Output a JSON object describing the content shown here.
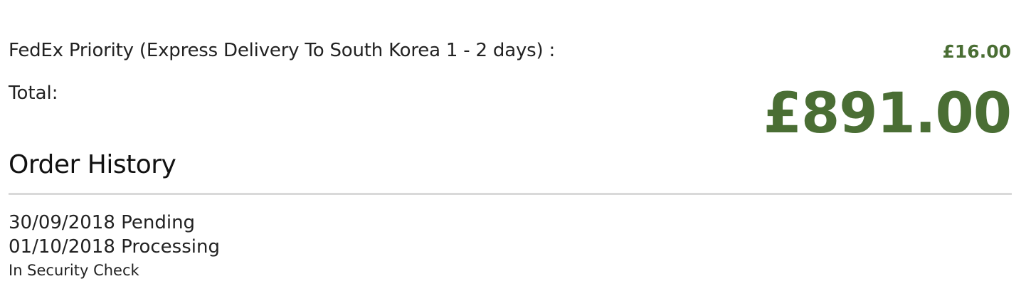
{
  "summary": {
    "shipping_label": "FedEx Priority (Express Delivery To South Korea 1 - 2 days) :",
    "shipping_price": "£16.00",
    "total_label": "Total:",
    "total_amount": "£891.00"
  },
  "order_history": {
    "title": "Order History",
    "entries": [
      {
        "text": "30/09/2018 Pending"
      },
      {
        "text": "01/10/2018 Processing"
      }
    ],
    "note": "In Security Check"
  },
  "colors": {
    "price_green": "#4a6e34",
    "divider_gray": "#d9d9d9",
    "text": "#222222"
  }
}
